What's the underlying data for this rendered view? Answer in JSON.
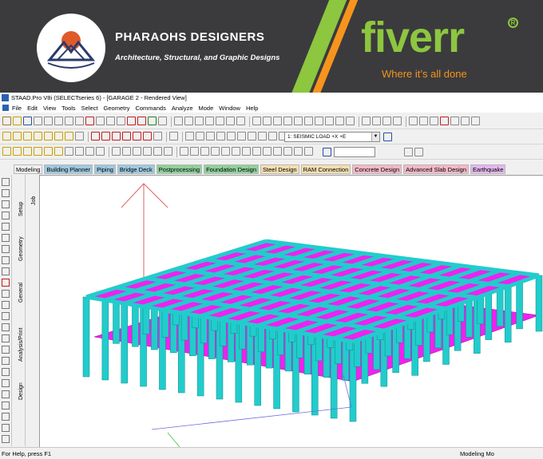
{
  "banner": {
    "brand_name": "PHARAOHS DESIGNERS",
    "brand_tagline": "Architecture, Structural, and Graphic Designs",
    "marketplace_name": "fiverr",
    "marketplace_tagline": "Where it’s all done",
    "colors": {
      "background": "#3b3b3d",
      "green": "#8dc63f",
      "orange": "#f7941d"
    }
  },
  "window": {
    "title": "STAAD.Pro V8i (SELECTseries 6) - [GARAGE 2 - Rendered View]",
    "app_icon": "staad-app-icon"
  },
  "menu": {
    "items": [
      "File",
      "Edit",
      "View",
      "Tools",
      "Select",
      "Geometry",
      "Commands",
      "Analyze",
      "Mode",
      "Window",
      "Help"
    ]
  },
  "toolbar": {
    "load_case": "1: SEISMIC LOAD +X +E"
  },
  "modes": {
    "tabs": [
      {
        "label": "Modeling",
        "bg": "#f0f0f0"
      },
      {
        "label": "Building Planner",
        "bg": "#9fc9e0"
      },
      {
        "label": "Piping",
        "bg": "#9fc9e0"
      },
      {
        "label": "Bridge Deck",
        "bg": "#9fc9e0"
      },
      {
        "label": "Postprocessing",
        "bg": "#8fd19a"
      },
      {
        "label": "Foundation Design",
        "bg": "#8fd19a"
      },
      {
        "label": "Steel Design",
        "bg": "#f4dfb0"
      },
      {
        "label": "RAM Connection",
        "bg": "#f4dfb0"
      },
      {
        "label": "Concrete Design",
        "bg": "#f3b9c8"
      },
      {
        "label": "Advanced Slab Design",
        "bg": "#f3b9c8"
      },
      {
        "label": "Earthquake",
        "bg": "#e4b7ef"
      }
    ]
  },
  "side_tabs": {
    "items": [
      "Setup",
      "Geometry",
      "General",
      "Analysis/Print",
      "Design"
    ],
    "job": "Job"
  },
  "model": {
    "column_color": "#22cccc",
    "slab_color": "#ee22ee",
    "axis_color": "#e06060"
  },
  "status": {
    "help_text": "For Help, press F1",
    "mode_text": "Modeling Mo"
  }
}
